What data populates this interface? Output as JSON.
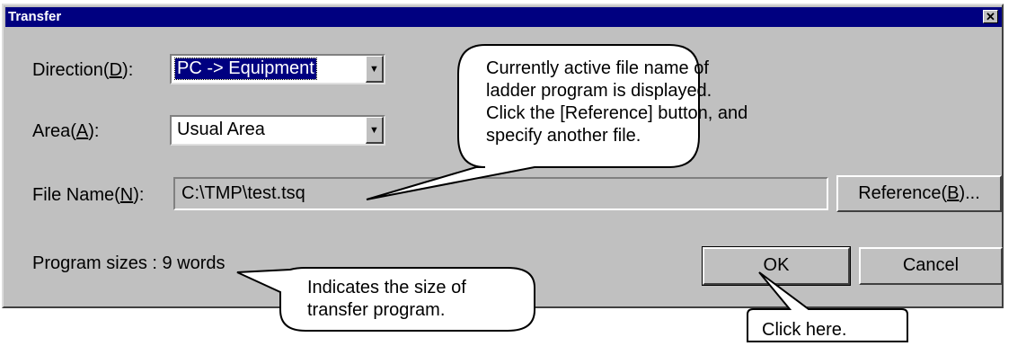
{
  "window": {
    "title": "Transfer",
    "close_glyph": "✕"
  },
  "form": {
    "direction": {
      "label_pre": "Direction(",
      "mnemonic": "D",
      "label_post": "):",
      "value": "PC -> Equipment"
    },
    "area": {
      "label_pre": "Area(",
      "mnemonic": "A",
      "label_post": "):",
      "value": "Usual Area"
    },
    "file_name": {
      "label_pre": "File Name(",
      "mnemonic": "N",
      "label_post": "):",
      "value": "C:\\TMP\\test.tsq"
    },
    "program_sizes": "Program sizes : 9 words"
  },
  "buttons": {
    "reference": {
      "pre": "Reference(",
      "mnemonic": "B",
      "post": ")..."
    },
    "ok": "OK",
    "cancel": "Cancel"
  },
  "callouts": {
    "file": [
      "Currently active file name of",
      "ladder program is displayed.",
      "Click the [Reference] button, and",
      "specify another file."
    ],
    "size": [
      "Indicates the size of",
      "transfer program."
    ],
    "ok": "Click here."
  },
  "icons": {
    "dropdown": "triangle-down-icon"
  },
  "colors": {
    "titlebar": "#000080",
    "face": "#c0c0c0",
    "selection": "#000080"
  }
}
